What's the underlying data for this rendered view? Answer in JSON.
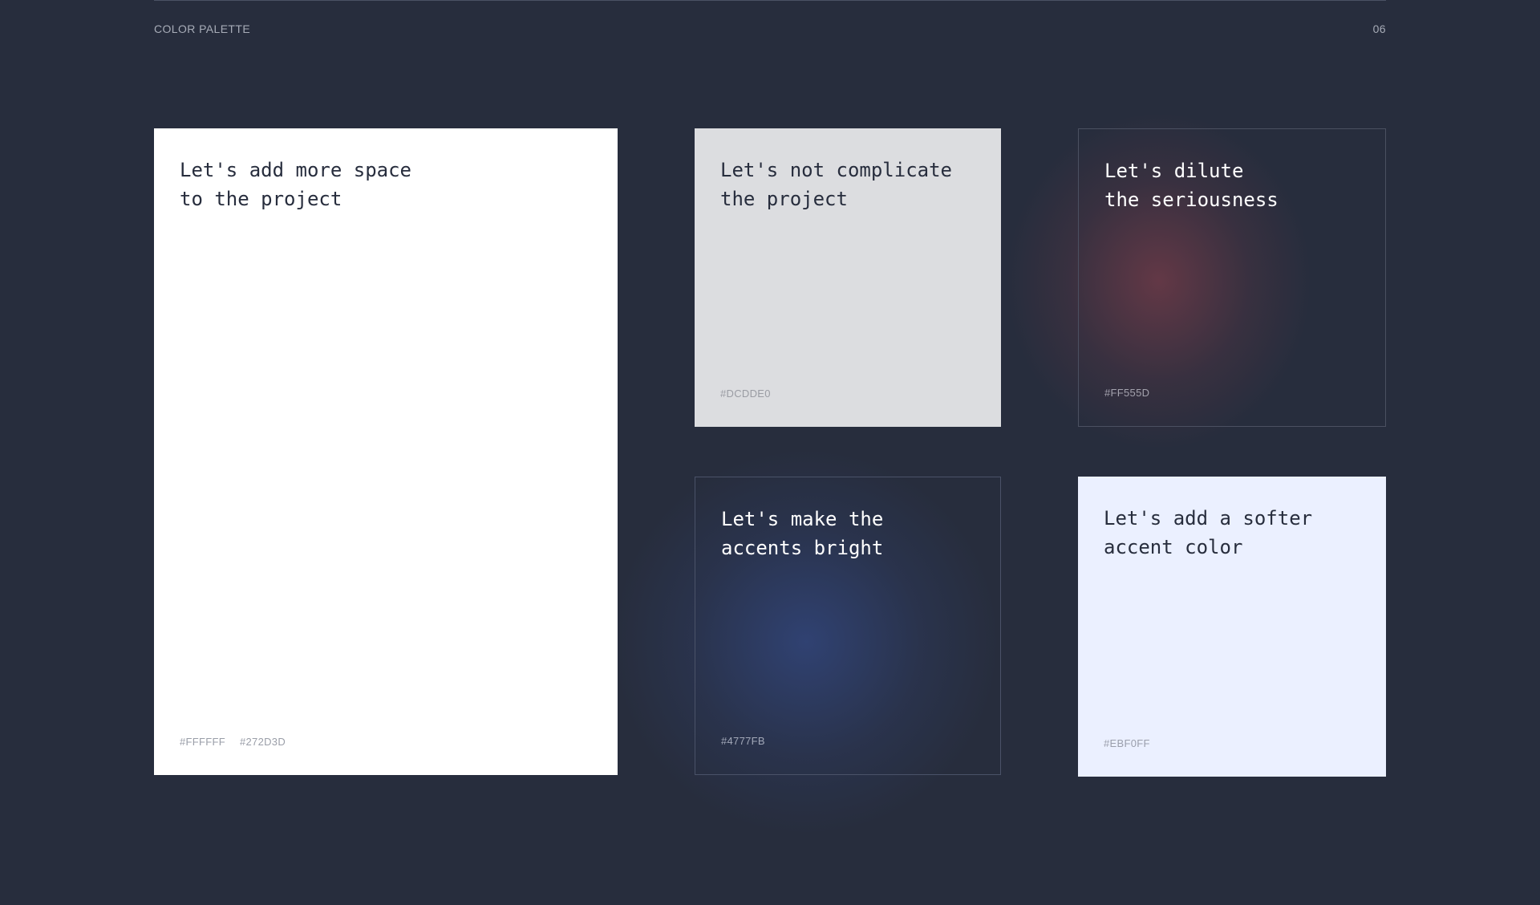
{
  "header": {
    "section_label": "COLOR PALETTE",
    "page_number": "06"
  },
  "cards": [
    {
      "title": "Let's add more space\nto the project",
      "codes": [
        "#FFFFFF",
        "#272D3D"
      ],
      "color": "#FFFFFF"
    },
    {
      "title": "Let's not complicate\nthe project",
      "codes": [
        "#DCDDE0"
      ],
      "color": "#DCDDE0"
    },
    {
      "title": "Let's dilute\nthe seriousness",
      "codes": [
        "#FF555D"
      ],
      "color": "#FF555D"
    },
    {
      "title": "Let's make the\naccents bright",
      "codes": [
        "#4777FB"
      ],
      "color": "#4777FB"
    },
    {
      "title": "Let's add a softer\naccent color",
      "codes": [
        "#EBF0FF"
      ],
      "color": "#EBF0FF"
    }
  ],
  "colors": {
    "background": "#272D3D"
  }
}
